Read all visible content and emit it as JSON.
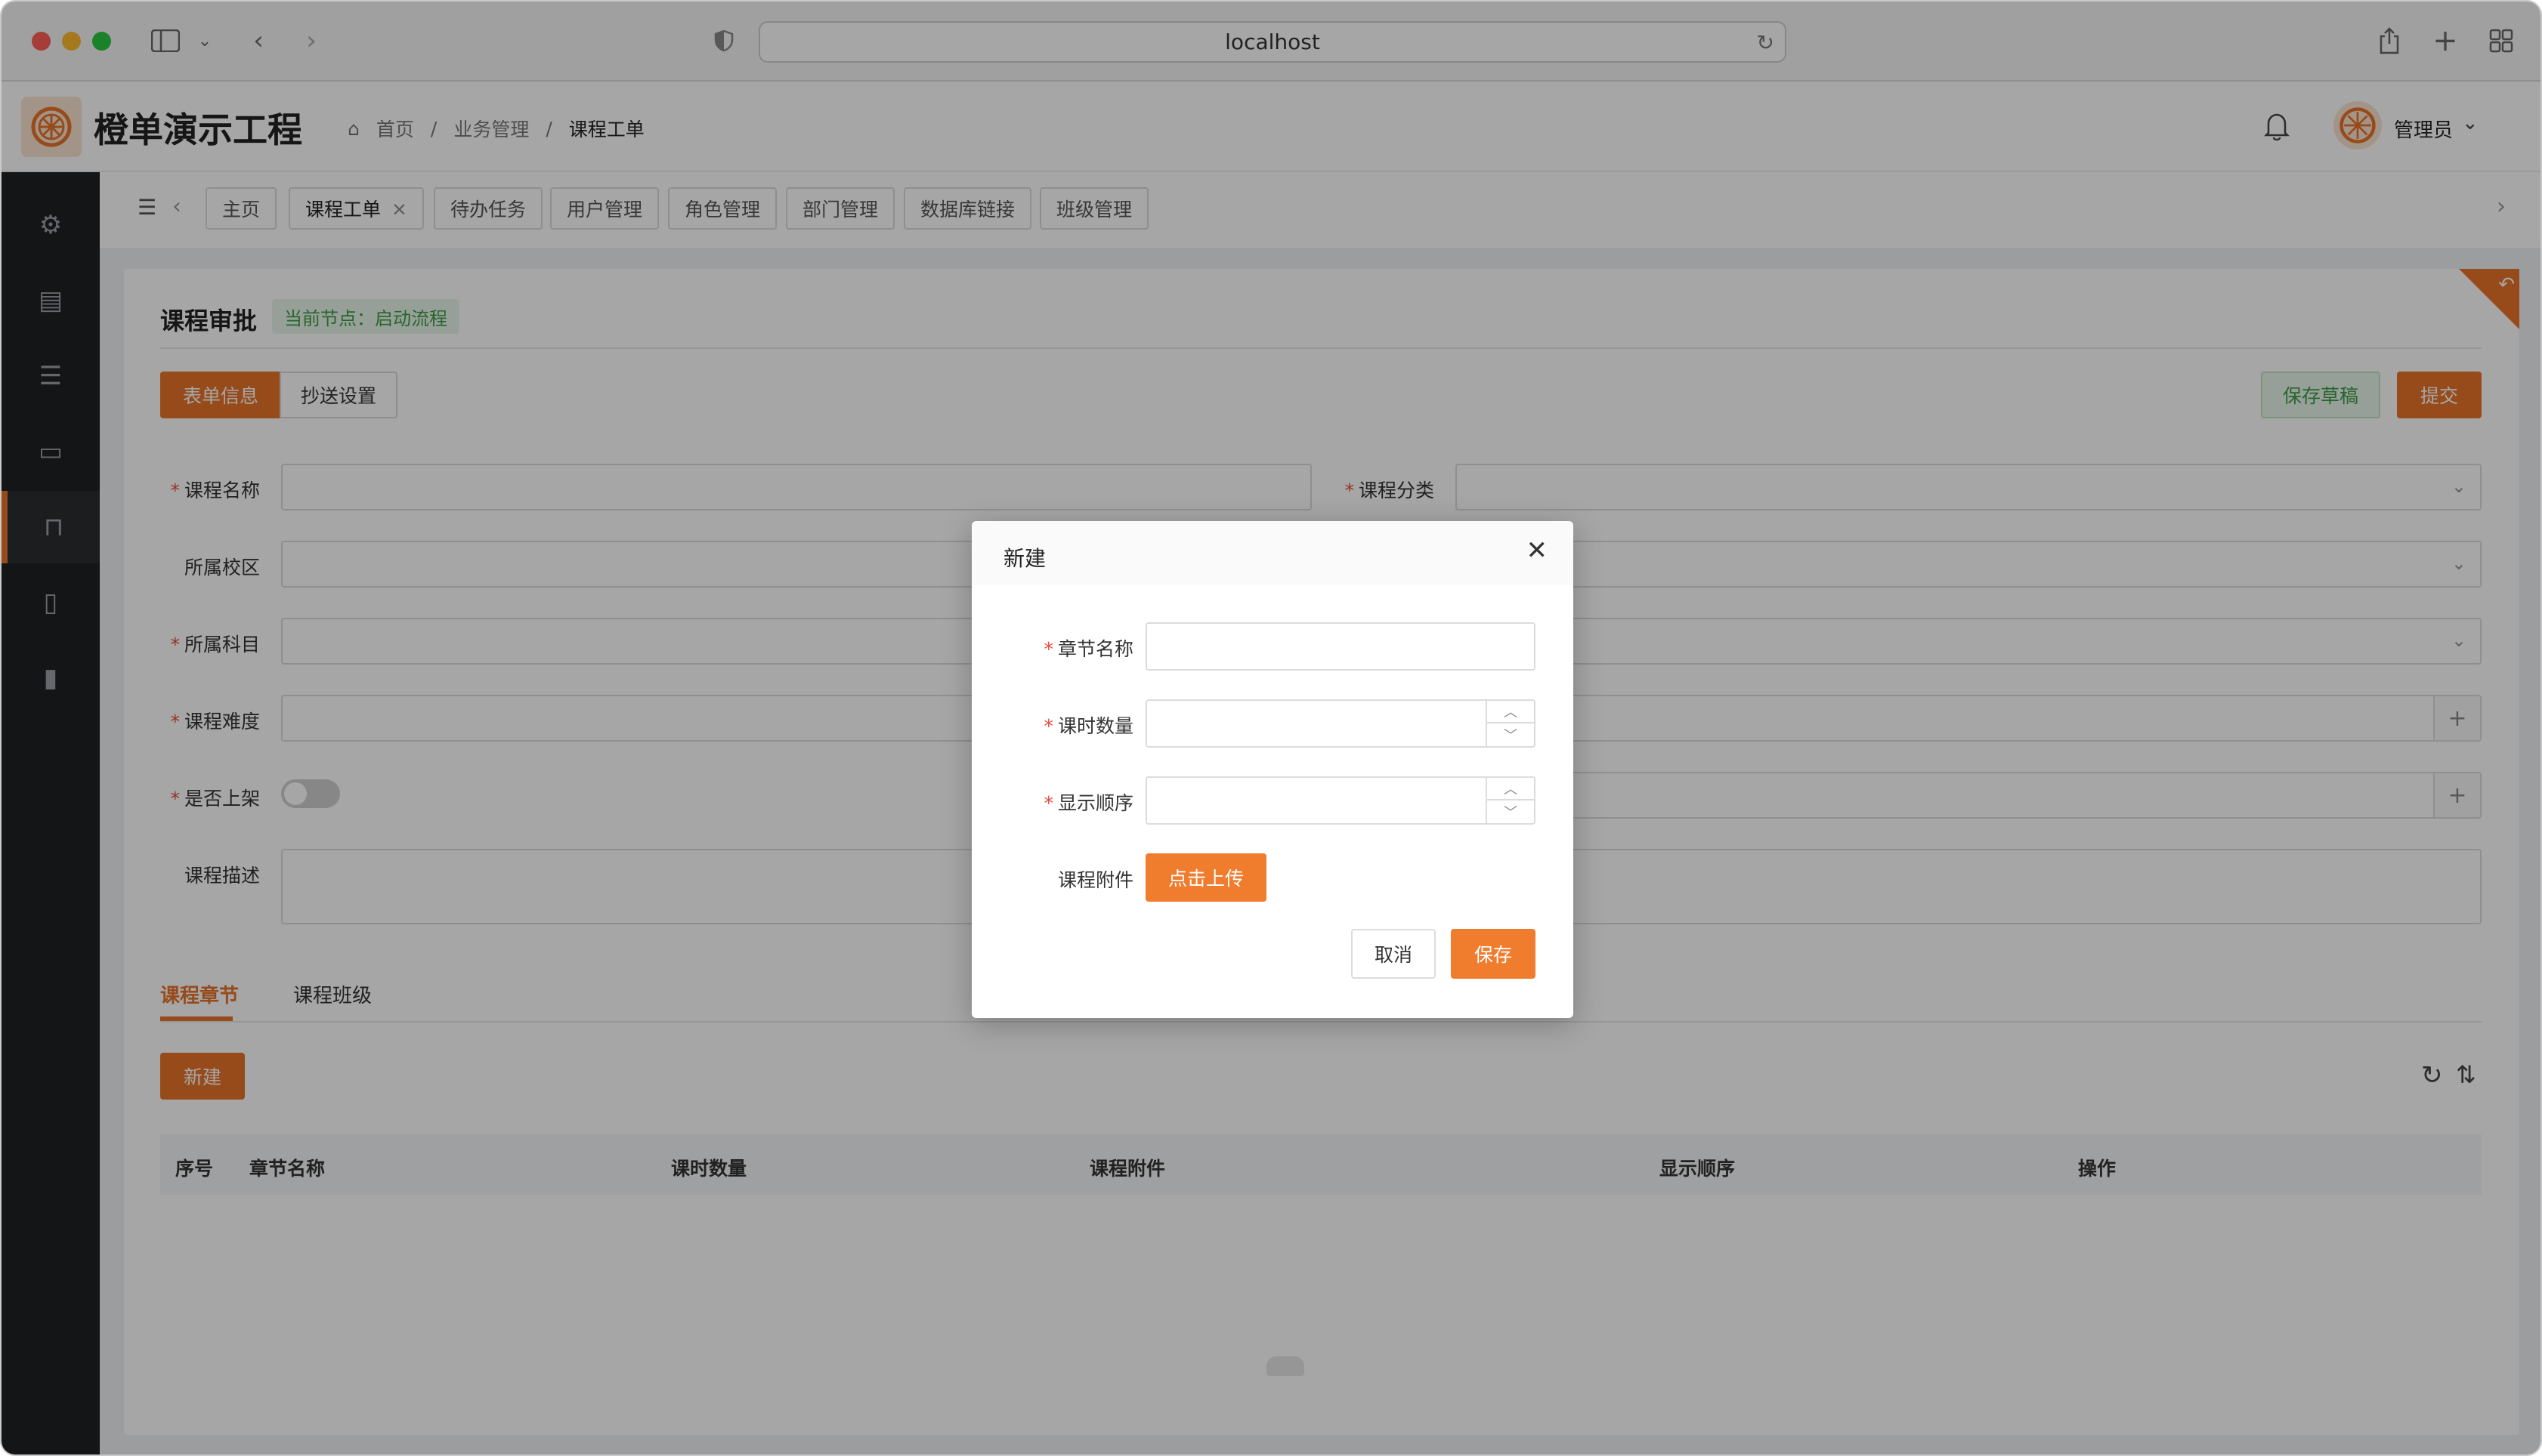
{
  "browser": {
    "url": "localhost"
  },
  "header": {
    "brand": "橙单演示工程",
    "breadcrumbs": [
      "首页",
      "业务管理",
      "课程工单"
    ],
    "user": "管理员"
  },
  "tabs": [
    "主页",
    "课程工单",
    "待办任务",
    "用户管理",
    "角色管理",
    "部门管理",
    "数据库链接",
    "班级管理"
  ],
  "page": {
    "title": "课程审批",
    "node": "当前节点：启动流程",
    "segments": [
      "表单信息",
      "抄送设置"
    ],
    "save_draft": "保存草稿",
    "submit": "提交",
    "fields": {
      "course_name": "课程名称",
      "course_category": "课程分类",
      "campus": "所属校区",
      "subject": "所属科目",
      "difficulty": "课程难度",
      "on_shelf": "是否上架",
      "description": "课程描述"
    },
    "subtabs": [
      "课程章节",
      "课程班级"
    ],
    "new_button": "新建",
    "table_headers": [
      "序号",
      "章节名称",
      "课时数量",
      "课程附件",
      "显示顺序",
      "操作"
    ]
  },
  "modal": {
    "title": "新建",
    "chapter_name": "章节名称",
    "hours": "课时数量",
    "order": "显示顺序",
    "attachment": "课程附件",
    "upload": "点击上传",
    "cancel": "取消",
    "save": "保存"
  },
  "colors": {
    "accent": "#e8742a",
    "green": "#3d9b46"
  }
}
